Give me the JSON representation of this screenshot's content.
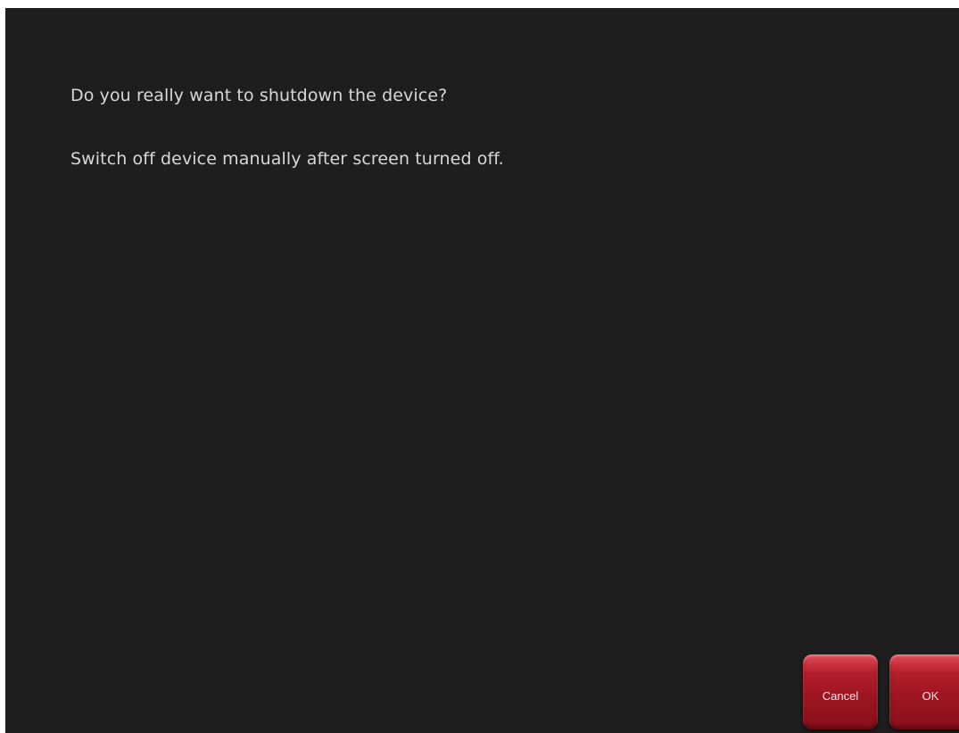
{
  "dialog": {
    "question": "Do you really want to shutdown the device?",
    "instruction": "Switch off device manually after screen turned off."
  },
  "buttons": {
    "cancel_label": "Cancel",
    "ok_label": "OK"
  },
  "colors": {
    "background": "#1e1e1e",
    "text": "#d8d8d8",
    "button_red": "#9e1622"
  }
}
